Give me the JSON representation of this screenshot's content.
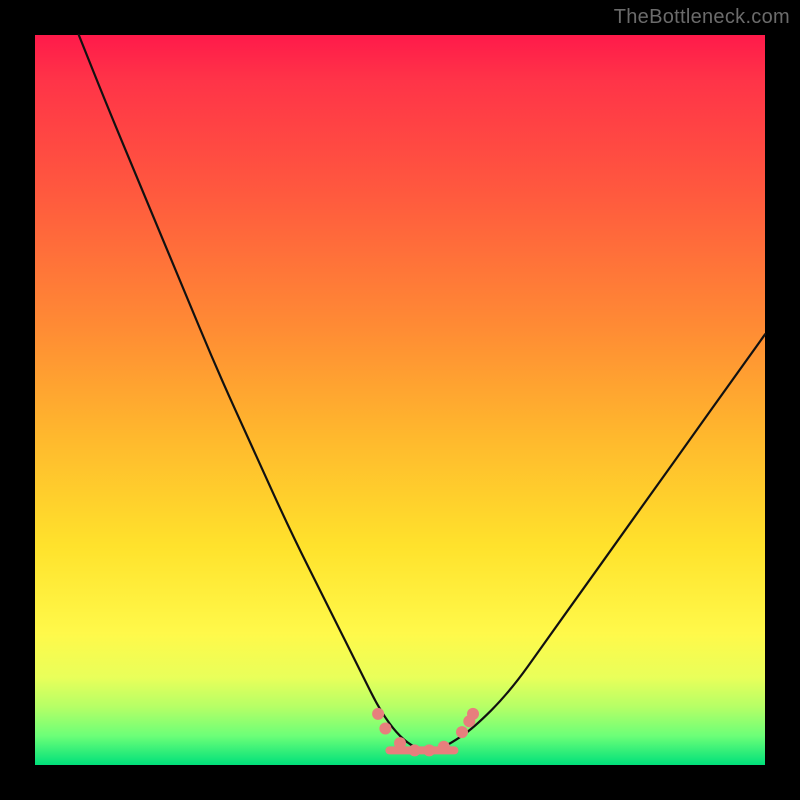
{
  "watermark": "TheBottleneck.com",
  "chart_data": {
    "type": "line",
    "title": "",
    "xlabel": "",
    "ylabel": "",
    "xlim": [
      0,
      100
    ],
    "ylim": [
      0,
      100
    ],
    "grid": false,
    "legend": false,
    "curve": {
      "name": "bottleneck-curve",
      "x": [
        6,
        10,
        15,
        20,
        25,
        30,
        35,
        40,
        45,
        47,
        49,
        51,
        53,
        55,
        57,
        60,
        65,
        70,
        75,
        80,
        85,
        90,
        95,
        100
      ],
      "y": [
        100,
        90,
        78,
        66,
        54,
        43,
        32,
        22,
        12,
        8,
        5,
        3,
        2,
        2,
        3,
        5,
        10,
        17,
        24,
        31,
        38,
        45,
        52,
        59
      ]
    },
    "markers": {
      "name": "optimal-points",
      "x": [
        47,
        48,
        50,
        52,
        54,
        56,
        58.5,
        59.5,
        60
      ],
      "y": [
        7,
        5,
        3,
        2,
        2,
        2.5,
        4.5,
        6,
        7
      ]
    },
    "annotations": []
  }
}
